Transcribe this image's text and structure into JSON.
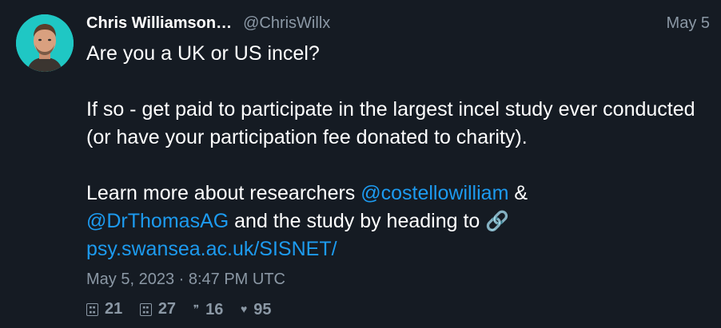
{
  "author": {
    "display_name": "Chris Williamson",
    "ellipsis": "…",
    "handle": "@ChrisWillx"
  },
  "date_short": "May 5",
  "body": {
    "line1": "Are you a UK or US incel?",
    "para2": "If so - get paid to participate in the largest incel study ever conducted (or have your participation fee donated to charity).",
    "para3_intro": "Learn more about researchers ",
    "mention1": "@costellowilliam",
    "amp": " & ",
    "mention2": "@DrThomasAG",
    "para3_middle": " and the study by heading to ",
    "link_icon": "🔗",
    "link_text": "psy.swansea.ac.uk/SISNET/"
  },
  "timestamp": "May 5, 2023 · 8:47 PM UTC",
  "stats": {
    "replies": {
      "icon": "reply-icon",
      "count": "21"
    },
    "retweets": {
      "icon": "retweet-icon",
      "count": "27"
    },
    "quotes": {
      "icon": "quote-icon",
      "count": "16"
    },
    "likes": {
      "icon": "heart-icon",
      "count": "95"
    }
  },
  "colors": {
    "background": "#151b23",
    "text": "#ffffff",
    "muted": "#8b98a5",
    "link": "#1d9bf0",
    "avatar_bg": "#1fc7c4"
  }
}
